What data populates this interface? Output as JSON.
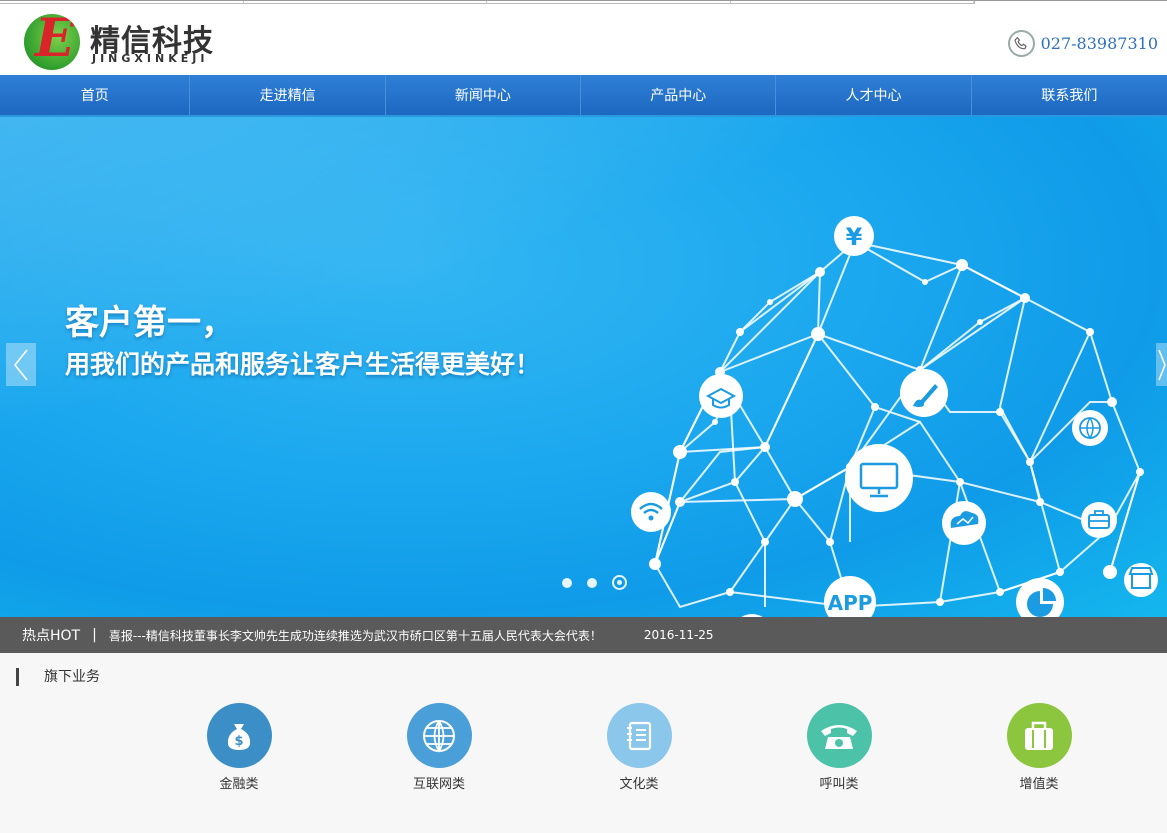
{
  "header": {
    "logo_cn": "精信科技",
    "logo_en": "JINGXINKEJI",
    "logo_mark": "E",
    "phone": "027-83987310"
  },
  "nav": {
    "items": [
      "首页",
      "走进精信",
      "新闻中心",
      "产品中心",
      "人才中心",
      "联系我们"
    ]
  },
  "banner": {
    "headline1": "客户第一，",
    "headline2": "用我们的产品和服务让客户生活得更美好！",
    "app_label": "APP",
    "yen_symbol": "¥",
    "slide_count": 3,
    "active_slide": 3
  },
  "hot": {
    "label": "热点HOT",
    "separator": "|",
    "news_title": "喜报---精信科技董事长李文帅先生成功连续推选为武汉市硚口区第十五届人民代表大会代表！",
    "news_date": "2016-11-25"
  },
  "business": {
    "title": "旗下业务",
    "items": [
      {
        "label": "金融类",
        "icon": "money-bag-icon",
        "color": "#3b8fc6"
      },
      {
        "label": "互联网类",
        "icon": "globe-icon",
        "color": "#4a9fd8"
      },
      {
        "label": "文化类",
        "icon": "notebook-icon",
        "color": "#8ac7ea"
      },
      {
        "label": "呼叫类",
        "icon": "telephone-icon",
        "color": "#4cc3a8"
      },
      {
        "label": "增值类",
        "icon": "briefcase-icon",
        "color": "#8cc63f"
      }
    ]
  },
  "colors": {
    "nav_blue": "#1d68c1",
    "phone_text": "#2d6fbf",
    "hot_bar": "#5a5a5a"
  }
}
